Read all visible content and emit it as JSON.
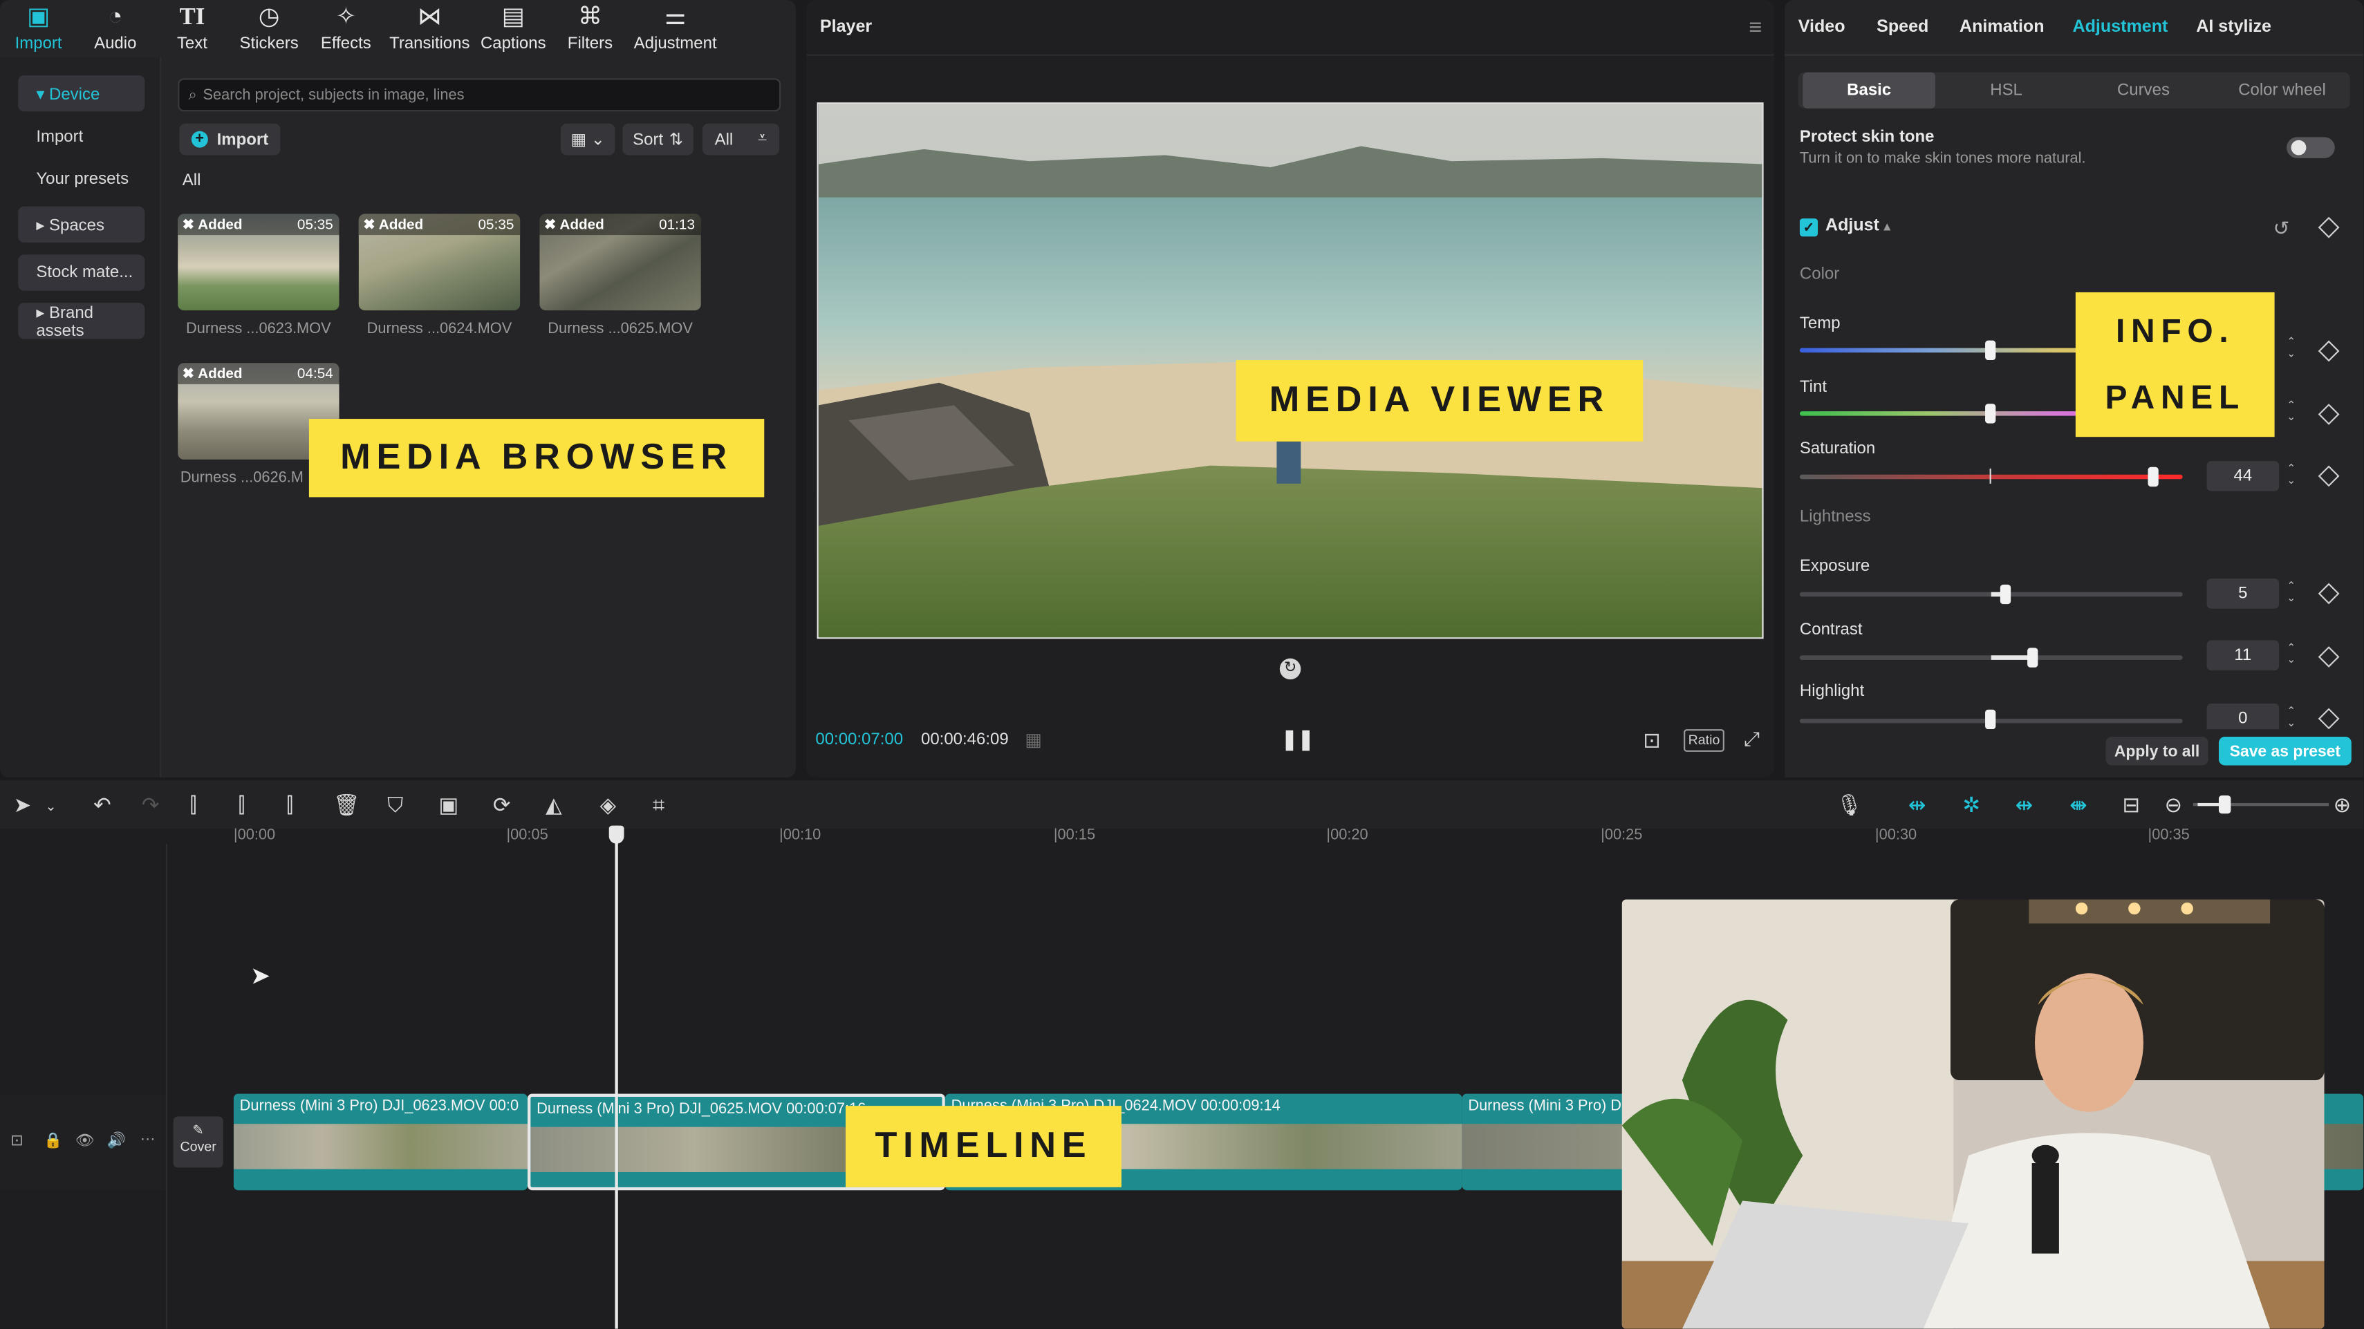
{
  "top_tabs": [
    {
      "label": "Import",
      "icon": "import-icon",
      "active": true
    },
    {
      "label": "Audio",
      "icon": "audio-icon"
    },
    {
      "label": "Text",
      "icon": "text-icon"
    },
    {
      "label": "Stickers",
      "icon": "stickers-icon"
    },
    {
      "label": "Effects",
      "icon": "effects-icon"
    },
    {
      "label": "Transitions",
      "icon": "transitions-icon"
    },
    {
      "label": "Captions",
      "icon": "captions-icon"
    },
    {
      "label": "Filters",
      "icon": "filters-icon"
    },
    {
      "label": "Adjustment",
      "icon": "adjustment-icon"
    }
  ],
  "sidebar": {
    "items": [
      {
        "label": "▾ Device"
      },
      {
        "label": "Import"
      },
      {
        "label": "Your presets"
      },
      {
        "label": "▸ Spaces"
      },
      {
        "label": "Stock mate..."
      },
      {
        "label": "▸ Brand assets"
      }
    ]
  },
  "media": {
    "search_placeholder": "Search project, subjects in image, lines",
    "import_label": "Import",
    "sort_label": "Sort",
    "all_button": "All",
    "filter_label": "All",
    "items": [
      {
        "tag": "Added",
        "duration": "05:35",
        "name": "Durness ...0623.MOV"
      },
      {
        "tag": "Added",
        "duration": "05:35",
        "name": "Durness ...0624.MOV"
      },
      {
        "tag": "Added",
        "duration": "01:13",
        "name": "Durness ...0625.MOV"
      },
      {
        "tag": "Added",
        "duration": "04:54",
        "name": "Durness ...0626.M"
      }
    ]
  },
  "overlays": {
    "media_browser": "MEDIA BROWSER",
    "media_viewer": "MEDIA VIEWER",
    "info_panel_1": "INFO.",
    "info_panel_2": "PANEL",
    "timeline": "TIMELINE"
  },
  "player": {
    "title": "Player",
    "current_time": "00:00:07:00",
    "total_time": "00:00:46:09",
    "ratio_label": "Ratio"
  },
  "inspector": {
    "tabs": [
      "Video",
      "Speed",
      "Animation",
      "Adjustment",
      "AI stylize"
    ],
    "active_tab": "Adjustment",
    "segments": [
      "Basic",
      "HSL",
      "Curves",
      "Color wheel"
    ],
    "protect_title": "Protect skin tone",
    "protect_desc": "Turn it on to make skin tones more natural.",
    "adjust_label": "Adjust",
    "color_section": "Color",
    "lightness_section": "Lightness",
    "temp_label": "Temp",
    "tint_label": "Tint",
    "saturation_label": "Saturation",
    "saturation_value": "44",
    "exposure_label": "Exposure",
    "exposure_value": "5",
    "contrast_label": "Contrast",
    "contrast_value": "11",
    "highlight_label": "Highlight",
    "highlight_value": "0",
    "apply_all": "Apply to all",
    "save_preset": "Save as preset"
  },
  "timeline": {
    "ticks": [
      "00:00",
      "00:05",
      "00:10",
      "00:15",
      "00:20",
      "00:25",
      "00:30",
      "00:35"
    ],
    "cover_label": "Cover",
    "clips": [
      {
        "title": "Durness (Mini 3 Pro) DJI_0623.MOV  00:0"
      },
      {
        "title": "Durness (Mini 3 Pro) DJI_0625.MOV  00:00:07:16"
      },
      {
        "title": "Durness (Mini 3 Pro) DJI_0624.MOV  00:00:09:14"
      },
      {
        "title": "Durness (Mini 3 Pro) D"
      }
    ]
  },
  "colors": {
    "accent": "#23c4d8",
    "highlight_yellow": "#fbe240",
    "clip_teal": "#1e8b8f"
  }
}
